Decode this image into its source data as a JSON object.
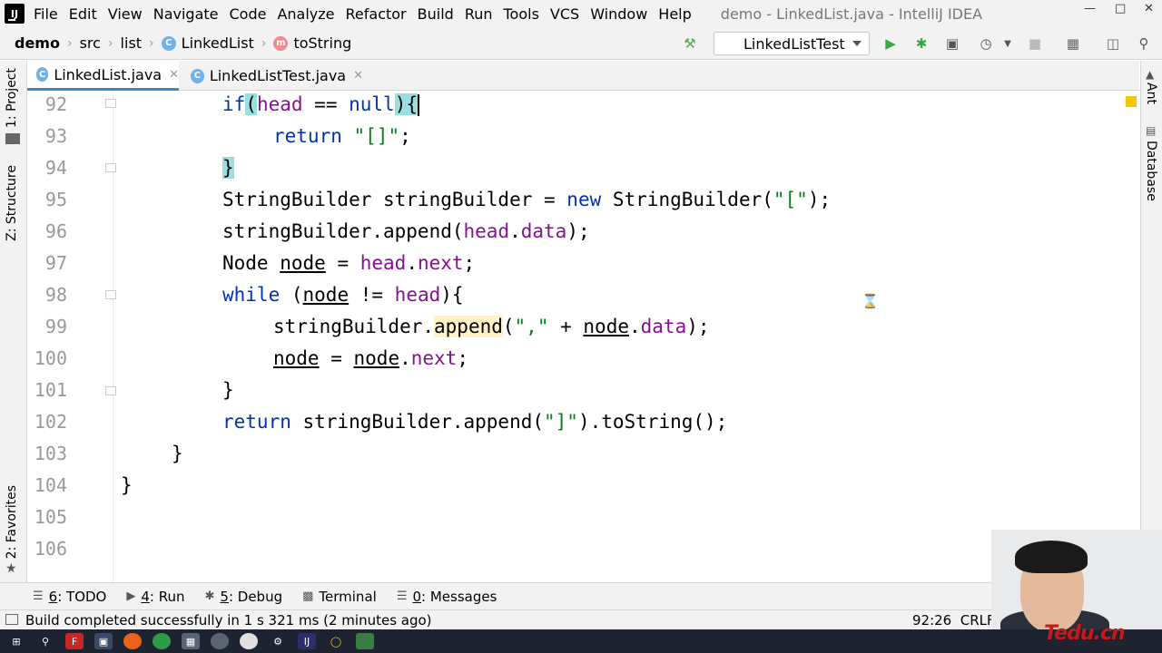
{
  "menubar": {
    "app_icon": "IJ",
    "items": [
      "File",
      "Edit",
      "View",
      "Navigate",
      "Code",
      "Analyze",
      "Refactor",
      "Build",
      "Run",
      "Tools",
      "VCS",
      "Window",
      "Help"
    ],
    "window_title": "demo - LinkedList.java - IntelliJ IDEA"
  },
  "navbar": {
    "breadcrumb": [
      "demo",
      "src",
      "list",
      "LinkedList",
      "toString"
    ],
    "run_config": "LinkedListTest"
  },
  "tabs": [
    {
      "label": "LinkedList.java",
      "active": true
    },
    {
      "label": "LinkedListTest.java",
      "active": false
    }
  ],
  "left_sidebar": [
    "1: Project",
    "Z: Structure",
    "2: Favorites"
  ],
  "right_sidebar": [
    "Ant",
    "Database"
  ],
  "editor": {
    "line_numbers": [
      "92",
      "93",
      "94",
      "95",
      "96",
      "97",
      "98",
      "99",
      "100",
      "101",
      "102",
      "103",
      "104",
      "105",
      "106"
    ],
    "lines": {
      "l92": {
        "a": "if",
        "b": "(",
        "c": "head",
        "d": " == ",
        "e": "null",
        "f": ")",
        "g": "{"
      },
      "l93": {
        "a": "return",
        "b": " ",
        "c": "\"[]\"",
        "d": ";"
      },
      "l94": {
        "a": "}"
      },
      "l95": {
        "a": "StringBuilder stringBuilder = ",
        "b": "new",
        "c": " StringBuilder(",
        "d": "\"[\"",
        "e": ");"
      },
      "l96": {
        "a": "stringBuilder.append(",
        "b": "head",
        "c": ".",
        "d": "data",
        "e": ");"
      },
      "l97": {
        "a": "Node ",
        "b": "node",
        "c": " = ",
        "d": "head",
        "e": ".",
        "f": "next",
        "g": ";"
      },
      "l98": {
        "a": "while",
        "b": " (",
        "c": "node",
        "d": " != ",
        "e": "head",
        "f": "){"
      },
      "l99": {
        "a": "stringBuilder.",
        "b": "append",
        "c": "(",
        "d": "\",\"",
        "e": " + ",
        "f": "node",
        "g": ".",
        "h": "data",
        "i": ");"
      },
      "l100": {
        "a": "node",
        "b": " = ",
        "c": "node",
        "d": ".",
        "e": "next",
        "f": ";"
      },
      "l101": {
        "a": "}"
      },
      "l102": {
        "a": "return",
        "b": " stringBuilder.append(",
        "c": "\"]\"",
        "d": ").toString();"
      },
      "l103": {
        "a": "}"
      },
      "l104": {
        "a": "}"
      }
    }
  },
  "bottom_tools": [
    {
      "key": "6",
      "label": ": TODO",
      "icon": "list-icon"
    },
    {
      "key": "4",
      "label": ": Run",
      "icon": "run-icon"
    },
    {
      "key": "5",
      "label": ": Debug",
      "icon": "bug-icon"
    },
    {
      "key": "",
      "label": "Terminal",
      "icon": "terminal-icon"
    },
    {
      "key": "0",
      "label": ": Messages",
      "icon": "messages-icon"
    }
  ],
  "status": {
    "message": "Build completed successfully in 1 s 321 ms (2 minutes ago)",
    "position": "92:26",
    "line_sep": "CRLF"
  },
  "watermark": "Tedu.cn",
  "colors": {
    "keyword": "#0033b3",
    "string": "#067d17",
    "field": "#871094",
    "brace_match": "#99dfe0"
  }
}
